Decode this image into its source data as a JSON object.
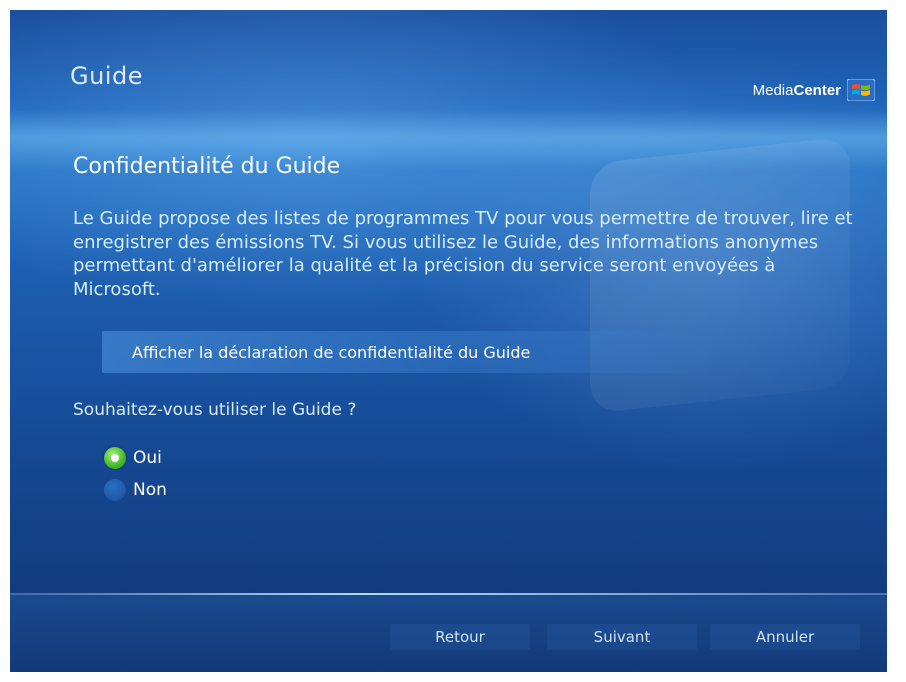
{
  "header": {
    "title": "Guide",
    "logo_text_light": "Media",
    "logo_text_bold": "Center"
  },
  "main": {
    "page_title": "Confidentialité du Guide",
    "description": "Le Guide propose des listes de programmes TV pour vous permettre de trouver, lire et enregistrer des émissions TV. Si vous utilisez le Guide, des informations anonymes permettant d'améliorer la qualité et la précision du service seront envoyées à Microsoft.",
    "privacy_link": "Afficher la déclaration de confidentialité du Guide",
    "question": "Souhaitez-vous utiliser le Guide ?",
    "options": [
      {
        "label": "Oui",
        "selected": true
      },
      {
        "label": "Non",
        "selected": false
      }
    ]
  },
  "footer": {
    "back_label": "Retour",
    "next_label": "Suivant",
    "cancel_label": "Annuler"
  },
  "colors": {
    "background": "#1d5eb0",
    "selected_radio": "#42b82a",
    "text_light_blue": "#d6ecff"
  },
  "icons": [
    "windows-flag-icon",
    "radio-selected-icon",
    "radio-unselected-icon"
  ]
}
